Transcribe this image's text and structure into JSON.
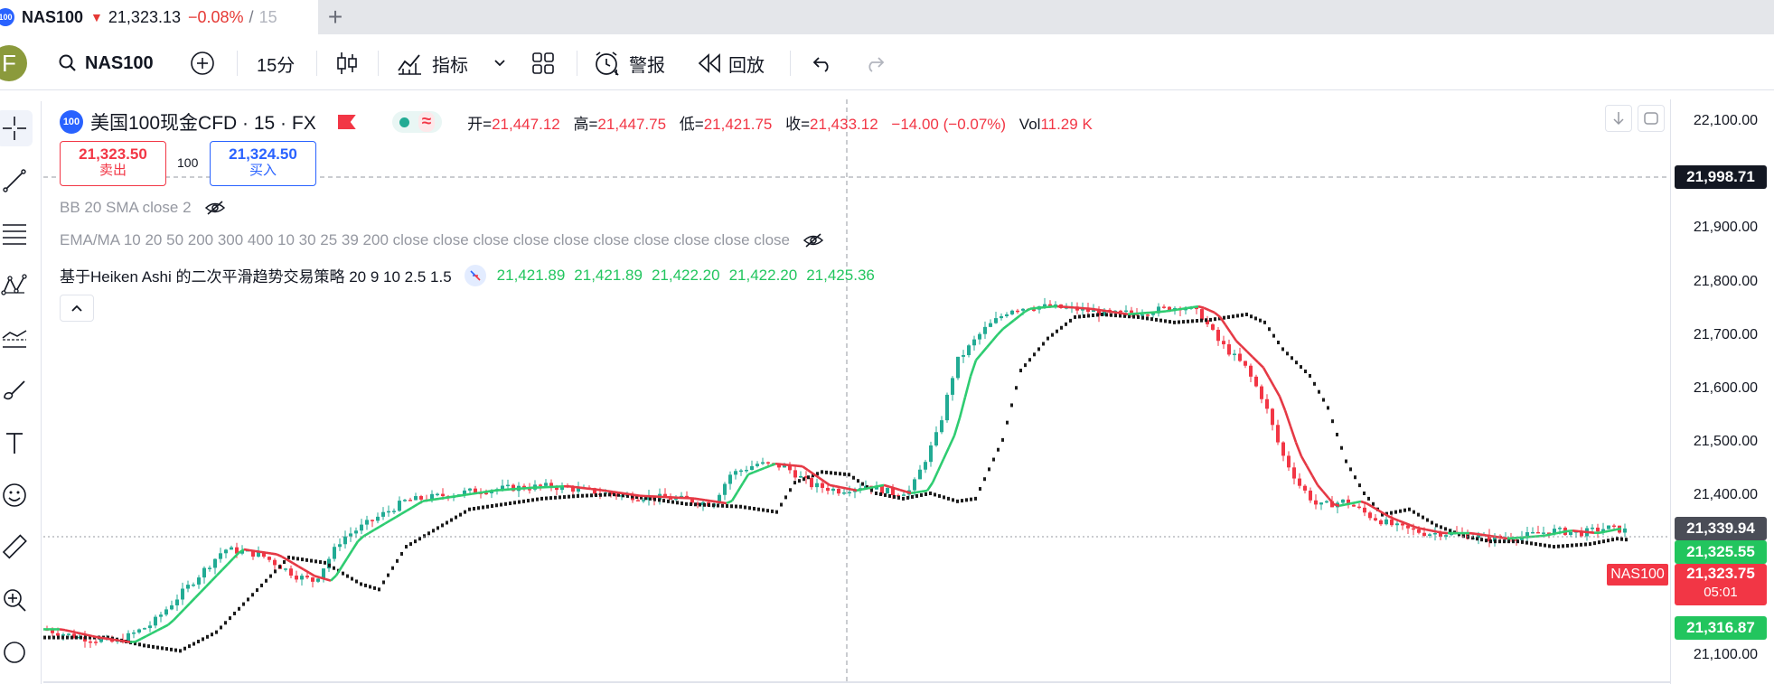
{
  "tab": {
    "favicon_text": "100",
    "symbol": "NAS100",
    "arrow": "▼",
    "price": "21,323.13",
    "change": "−0.08%",
    "separator": "/",
    "more": "15"
  },
  "toolbar": {
    "avatar_letter": "F",
    "search_symbol": "NAS100",
    "interval": "15分",
    "indicators": "指标",
    "alerts": "警报",
    "replay": "回放"
  },
  "legend": {
    "badge": "100",
    "title": "美国100现金CFD · 15 · FX",
    "open_label": "开=",
    "open": "21,447.12",
    "high_label": "高=",
    "high": "21,447.75",
    "low_label": "低=",
    "low": "21,421.75",
    "close_label": "收=",
    "close": "21,433.12",
    "change": "−14.00 (−0.07%)",
    "vol_label": "Vol",
    "vol": "11.29 K",
    "trend_symbol": "≈"
  },
  "trade": {
    "sell_price": "21,323.50",
    "sell_label": "卖出",
    "spread": "100",
    "buy_price": "21,324.50",
    "buy_label": "买入"
  },
  "indicators": {
    "bb": "BB 20 SMA close 2",
    "ema": "EMA/MA 10 20 50 200 300 400 10 30 25 39 200 close close close close close close close close close close",
    "strategy": "基于Heiken Ashi 的二次平滑趋势交易策略 20 9 10 2.5 1.5",
    "strategy_values": [
      "21,421.89",
      "21,421.89",
      "21,422.20",
      "21,422.20",
      "21,425.36"
    ]
  },
  "axis": {
    "ticks": [
      "22,100.00",
      "21,900.00",
      "21,800.00",
      "21,700.00",
      "21,600.00",
      "21,500.00",
      "21,400.00",
      "21,100.00"
    ],
    "crosshair_price": "21,998.71",
    "label_1": "21,339.94",
    "label_2": "21,325.55",
    "nas_tag": "NAS100",
    "current_price": "21,323.75",
    "countdown": "05:01",
    "label_4": "21,316.87"
  },
  "colors": {
    "up": "#22ab94",
    "down": "#f23645",
    "green_line": "#2ecc71",
    "red_line": "#e53945",
    "accent": "#2962ff"
  }
}
